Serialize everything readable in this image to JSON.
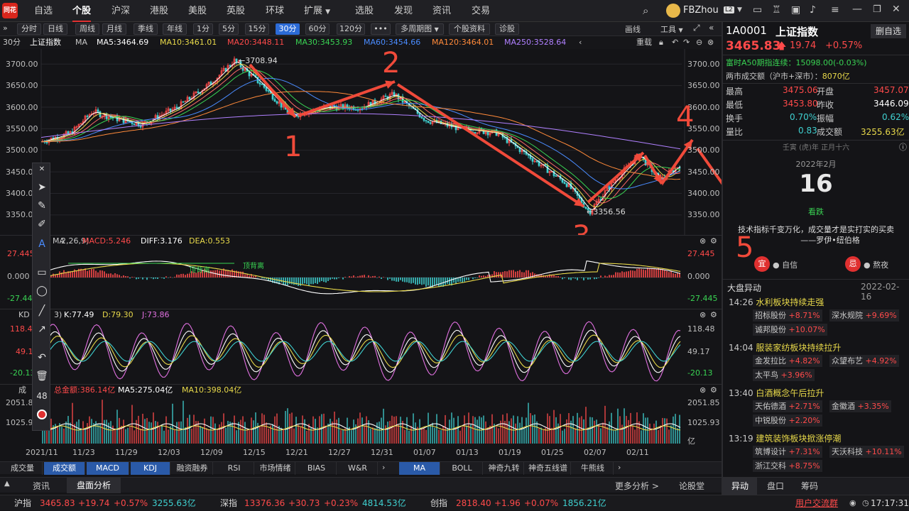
{
  "topnav": {
    "logo": "同花顺",
    "items": [
      "自选",
      "个股",
      "沪深",
      "港股",
      "美股",
      "英股",
      "环球",
      "扩展",
      "选股",
      "发现",
      "资讯",
      "交易"
    ],
    "active": "个股",
    "user": "FBZhou",
    "level_badge": "L2"
  },
  "toolbar": {
    "periods": [
      "分时",
      "日线",
      "周线",
      "月线",
      "季线",
      "年线",
      "1分",
      "5分",
      "15分",
      "30分",
      "60分",
      "120分"
    ],
    "active": "30分",
    "more": "•••",
    "multi_period": "多周期图",
    "stock_info": "个股资料",
    "diagnose": "诊股",
    "draw_line": "画线",
    "tools": "工具"
  },
  "chart_header": {
    "period": "30分",
    "name": "上证指数",
    "ma_label": "MA",
    "ma5": "MA5:3464.69",
    "ma10": "MA10:3461.01",
    "ma20": "MA20:3448.11",
    "ma30": "MA30:3453.93",
    "ma60": "MA60:3454.66",
    "ma120": "MA120:3464.01",
    "ma250": "MA250:3528.64",
    "reset": "重载"
  },
  "colors": {
    "up": "#ff4a4a",
    "down": "#39d353",
    "ma5": "#ffffff",
    "ma10": "#e8d94a",
    "ma20": "#ff6a6a",
    "ma30": "#39d353",
    "ma60": "#4a8cff",
    "ma120": "#ff8a3a",
    "ma250": "#b080ff",
    "annotation": "#f04a3a"
  },
  "price_axis": [
    "3700.00",
    "3650.00",
    "3600.00",
    "3550.00",
    "3500.00",
    "3450.00",
    "3400.00",
    "3350.00"
  ],
  "price_markers": {
    "high": "3708.94",
    "low": "3356.56"
  },
  "annotations": [
    "1",
    "2",
    "3",
    "4",
    "5"
  ],
  "macd": {
    "label": "MA",
    "params": "2,26,9)",
    "macd": "MACD:5.246",
    "diff": "DIFF:3.176",
    "dea": "DEA:0.553",
    "axis": [
      "27.445",
      "0.000",
      "-27.445"
    ],
    "notes": [
      "顶背离",
      "顶背离"
    ]
  },
  "kdj": {
    "label": "KD",
    "params": "3)",
    "k": "K:77.49",
    "d": "D:79.30",
    "j": "J:73.86",
    "axis": [
      "118.48",
      "49.17",
      "-20.13"
    ]
  },
  "volume": {
    "label": "成",
    "amount": "总金额:386.14亿",
    "ma5": "MA5:275.04亿",
    "ma10": "MA10:398.04亿",
    "axis": [
      "2051.85",
      "1025.93"
    ],
    "unit": "亿"
  },
  "date_axis": [
    "2021/11",
    "11/23",
    "11/29",
    "12/03",
    "12/09",
    "12/15",
    "12/21",
    "12/27",
    "12/31",
    "01/07",
    "01/13",
    "01/19",
    "01/25",
    "02/07",
    "02/11"
  ],
  "draw_tool_count": "48",
  "bottom_tabs": [
    "成交量",
    "成交额",
    "MACD",
    "KDJ",
    "融资融券",
    "RSI",
    "市场情绪",
    "BIAS",
    "W&R",
    "MA",
    "BOLL",
    "神奇九转",
    "神奇五线谱",
    "牛熊线"
  ],
  "bottom_tabs_active": [
    "成交额",
    "MACD",
    "KDJ",
    "MA"
  ],
  "info_tabs": [
    "资讯",
    "盘面分析"
  ],
  "info_active": "盘面分析",
  "more_analysis": "更多分析 >",
  "forum": "论股堂",
  "quote": {
    "code": "1A0001",
    "name": "上证指数",
    "delete_btn": "删自选",
    "price": "3465.83",
    "change": "19.74",
    "pct": "+0.57%",
    "a50": "富时A50期指连续：15098.00(-0.03%)",
    "turnover_label": "两市成交额（沪市+深市）：",
    "turnover_value": "8070亿",
    "rows": [
      {
        "l1": "最高",
        "v1": "3475.06",
        "l2": "开盘",
        "v2": "3457.07"
      },
      {
        "l1": "最低",
        "v1": "3453.80",
        "l2": "昨收",
        "v2": "3446.09"
      },
      {
        "l1": "换手",
        "v1": "0.70%",
        "l2": "振幅",
        "v2": "0.62%"
      },
      {
        "l1": "量比",
        "v1": "0.83",
        "l2": "成交额",
        "v2": "3255.63亿"
      }
    ]
  },
  "calendar": {
    "lunar": "壬寅 (虎)年 正月十六",
    "month": "2022年2月",
    "day": "16",
    "mood": "看跌",
    "quote": "技术指标千变万化，成交量才是实打实的买卖",
    "author": "——罗伊•纽伯格",
    "good_badge": "宜",
    "good": "● 自信",
    "bad_badge": "忌",
    "bad": "● 熬夜"
  },
  "movers": {
    "title": "大盘异动",
    "date": "2022-02-16",
    "groups": [
      {
        "time": "14:26",
        "title": "水利板块持续走强",
        "stocks": [
          {
            "name": "招标股份",
            "pct": "+8.71%"
          },
          {
            "name": "深水规院",
            "pct": "+9.69%"
          },
          {
            "name": "诚邦股份",
            "pct": "+10.07%"
          }
        ]
      },
      {
        "time": "14:04",
        "title": "服装家纺板块持续拉升",
        "stocks": [
          {
            "name": "金发拉比",
            "pct": "+4.82%"
          },
          {
            "name": "众望布艺",
            "pct": "+4.92%"
          },
          {
            "name": "太平鸟",
            "pct": "+3.96%"
          }
        ]
      },
      {
        "time": "13:40",
        "title": "白酒概念午后拉升",
        "stocks": [
          {
            "name": "天佑德酒",
            "pct": "+2.71%"
          },
          {
            "name": "金徽酒",
            "pct": "+3.35%"
          },
          {
            "name": "中锐股份",
            "pct": "+2.20%"
          }
        ]
      },
      {
        "time": "13:19",
        "title": "建筑装饰板块掀涨停潮",
        "stocks": [
          {
            "name": "筑博设计",
            "pct": "+7.31%"
          },
          {
            "name": "天沃科技",
            "pct": "+10.11%"
          },
          {
            "name": "浙江交科",
            "pct": "+8.75%"
          }
        ]
      }
    ]
  },
  "right_tabs": [
    "异动",
    "盘口",
    "筹码"
  ],
  "right_tabs_active": "异动",
  "status": {
    "sh": {
      "name": "沪指",
      "price": "3465.83",
      "chg": "+19.74",
      "pct": "+0.57%",
      "amt": "3255.63亿"
    },
    "sz": {
      "name": "深指",
      "price": "13376.36",
      "chg": "+30.73",
      "pct": "+0.23%",
      "amt": "4814.53亿"
    },
    "cy": {
      "name": "创指",
      "price": "2818.40",
      "chg": "+1.96",
      "pct": "+0.07%",
      "amt": "1856.21亿"
    },
    "group": "用户交流群",
    "time": "17:17:31"
  }
}
